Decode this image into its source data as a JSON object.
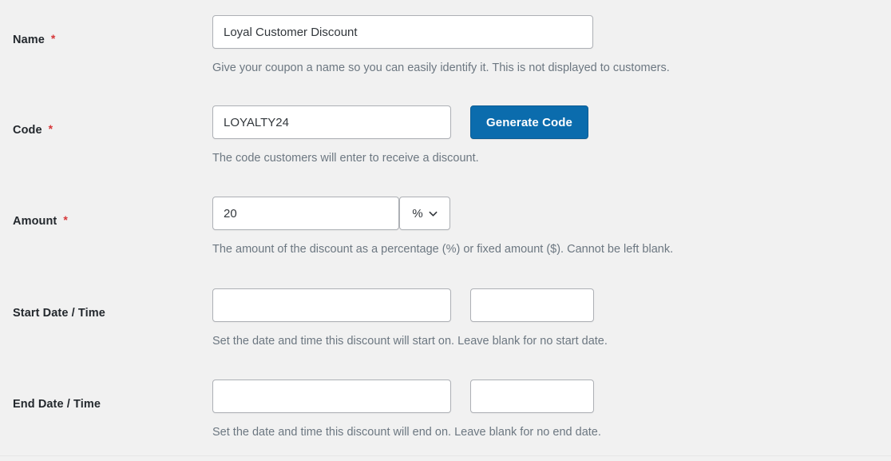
{
  "theme": {
    "background": "#f1f1f1",
    "label_color": "#23282d",
    "description_color": "#6c7781",
    "required_color": "#d63638",
    "button_background": "#0b6cad",
    "button_text": "#ffffff",
    "input_border": "#adb0b5"
  },
  "form": {
    "fields": [
      {
        "id": "name",
        "label": "Name",
        "required_marker": "*",
        "value": "Loyal Customer Discount",
        "placeholder": "",
        "description": "Give your coupon a name so you can easily identify it. This is not displayed to customers."
      },
      {
        "id": "code",
        "label": "Code",
        "required_marker": "*",
        "value": "LOYALTY24",
        "placeholder": "",
        "button_label": "Generate Code",
        "description": "The code customers will enter to receive a discount."
      },
      {
        "id": "amount",
        "label": "Amount",
        "required_marker": "*",
        "value": "20",
        "placeholder": "",
        "unit_selected": "%",
        "unit_options": [
          "%",
          "$"
        ],
        "description": "The amount of the discount as a percentage (%) or fixed amount ($). Cannot be left blank."
      },
      {
        "id": "start_date_time",
        "label": "Start Date / Time",
        "required_marker": "",
        "date_value": "",
        "date_placeholder": "",
        "time_value": "",
        "time_placeholder": "",
        "description": "Set the date and time this discount will start on. Leave blank for no start date."
      },
      {
        "id": "end_date_time",
        "label": "End Date / Time",
        "required_marker": "",
        "date_value": "",
        "date_placeholder": "",
        "time_value": "",
        "time_placeholder": "",
        "description": "Set the date and time this discount will end on. Leave blank for no end date."
      }
    ]
  },
  "icons": {
    "chevron_down": "chevron-down-icon"
  }
}
